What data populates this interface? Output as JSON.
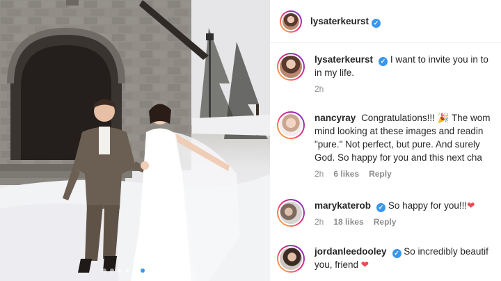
{
  "post": {
    "author": "lysaterkeurst",
    "photo": {
      "description_icon": "wedding-photo",
      "carousel_dot_count": 9,
      "carousel_active_index": 5
    }
  },
  "header": {
    "username": "lysaterkeurst",
    "verified": true
  },
  "comments": [
    {
      "username": "lysaterkeurst",
      "verified": true,
      "lines": [
        "I want to invite you in to",
        "in my life."
      ],
      "time": "2h",
      "likes": "",
      "reply": ""
    },
    {
      "username": "nancyray",
      "verified": false,
      "lines": [
        "Congratulations!!! 🎉 The wom",
        "mind looking at these images and readin",
        "\"pure.\" Not perfect, but pure. And surely",
        "God. So happy for you and this next cha"
      ],
      "time": "2h",
      "likes": "6 likes",
      "reply": "Reply"
    },
    {
      "username": "marykaterob",
      "verified": true,
      "lines": [
        "So happy for you!!!❤️"
      ],
      "time": "2h",
      "likes": "18 likes",
      "reply": "Reply"
    },
    {
      "username": "jordanleedooley",
      "verified": true,
      "lines": [
        "So incredibly beautif",
        "you, friend ❤️"
      ],
      "time": "",
      "likes": "",
      "reply": ""
    }
  ],
  "colors": {
    "verified_blue": "#3897f0",
    "meta_gray": "#8e8e8e",
    "text": "#262626"
  }
}
